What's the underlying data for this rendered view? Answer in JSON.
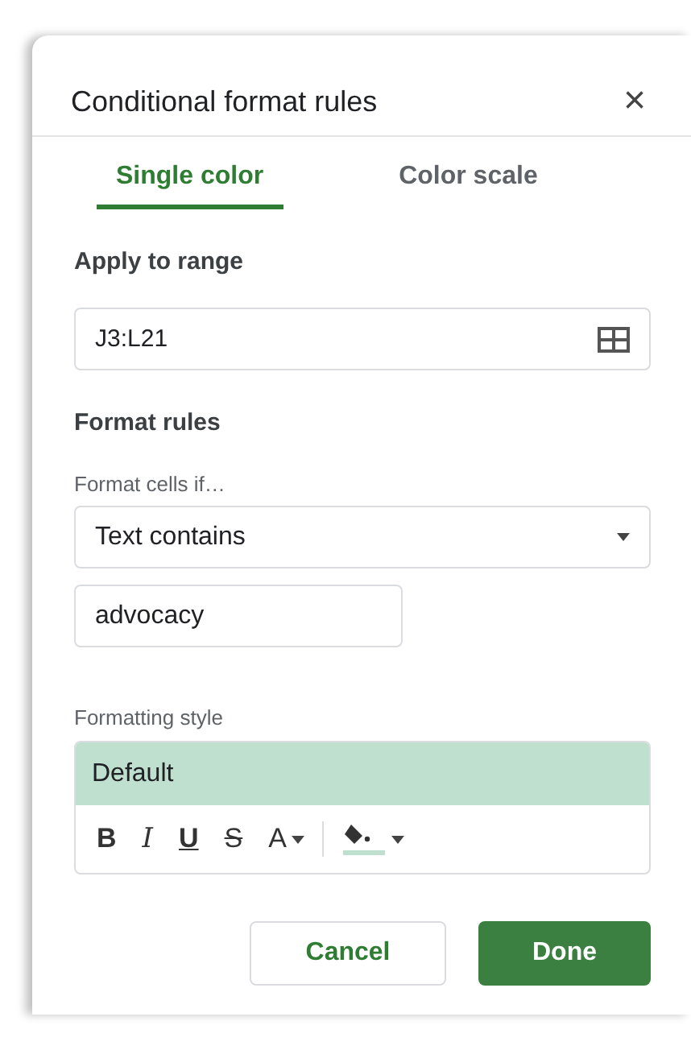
{
  "panel": {
    "title": "Conditional format rules",
    "close": "×"
  },
  "tabs": [
    {
      "label": "Single color",
      "selected": true
    },
    {
      "label": "Color scale",
      "selected": false
    }
  ],
  "range": {
    "heading": "Apply to range",
    "value": "J3:L21"
  },
  "rules": {
    "heading": "Format rules",
    "condition_label": "Format cells if…",
    "condition": "Text contains",
    "value": "advocacy"
  },
  "style": {
    "label": "Formatting style",
    "preview": "Default",
    "tools": [
      {
        "kind": "bold",
        "label": "B"
      },
      {
        "kind": "italic",
        "label": "I"
      },
      {
        "kind": "underline",
        "label": "U"
      },
      {
        "kind": "strike",
        "label": "S"
      },
      {
        "kind": "textcolor",
        "label": "A"
      },
      {
        "kind": "fill"
      }
    ]
  },
  "buttons": [
    {
      "label": "Cancel",
      "kind": "secondary"
    },
    {
      "label": "Done",
      "kind": "primary"
    }
  ]
}
